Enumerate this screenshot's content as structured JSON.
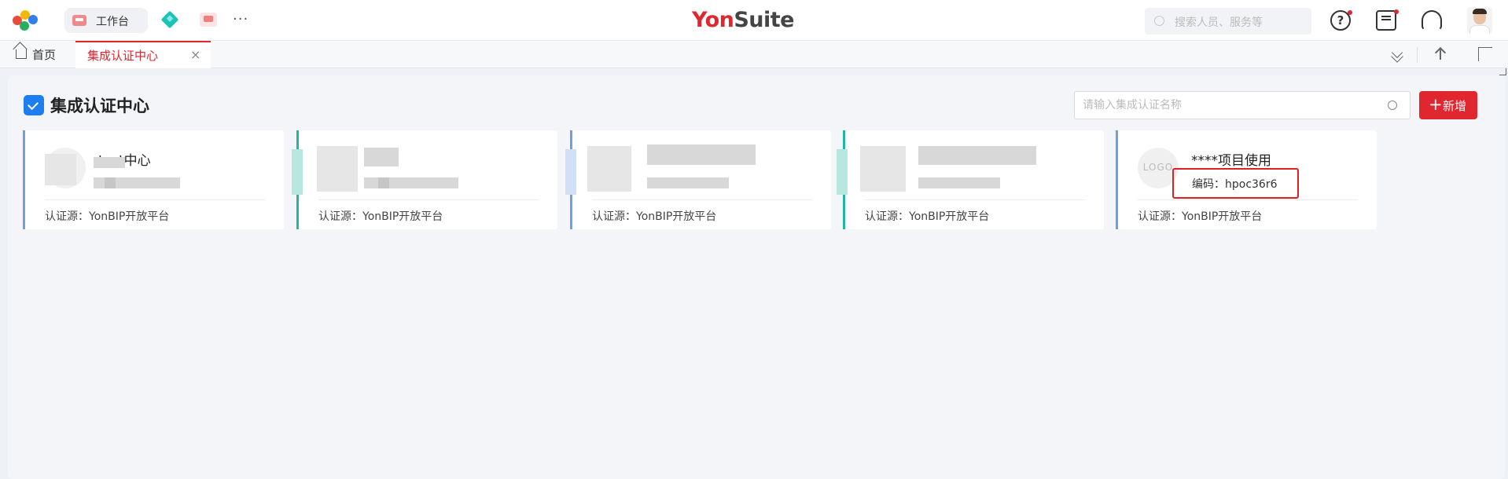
{
  "topbar": {
    "workbench_label": "工作台",
    "more_label": "···",
    "brand_prefix": "Yon",
    "brand_suffix": "Suite",
    "search_placeholder": "搜索人员、服务等",
    "help_label": "?"
  },
  "tabs": {
    "home_label": "首页",
    "active_label": "集成认证中心",
    "close_label": "×"
  },
  "page": {
    "title": "集成认证中心",
    "search_placeholder": "请输入集成认证名称",
    "add_plus": "+",
    "add_label": "新增"
  },
  "cards": [
    {
      "name": "test中心",
      "code": "",
      "source": "认证源：YonBIP开放平台",
      "accent": "#6f9fe0"
    },
    {
      "name": "",
      "code": "",
      "source": "认证源：YonBIP开放平台",
      "accent": "#1fb8a4"
    },
    {
      "name": "",
      "code": "",
      "source": "认证源：YonBIP开放平台",
      "accent": "#6f9fe0"
    },
    {
      "name": "",
      "code": "",
      "source": "认证源：YonBIP开放平台",
      "accent": "#1fb8a4"
    },
    {
      "name": "****项目使用",
      "code": "编码：hpoc36r6",
      "source": "认证源：YonBIP开放平台",
      "accent": "#6f9fe0",
      "logo_text": "LOGO"
    }
  ],
  "colors": {
    "brand_red": "#e0262f",
    "primary_blue": "#1d7ef2",
    "highlight_red": "#e02020"
  }
}
